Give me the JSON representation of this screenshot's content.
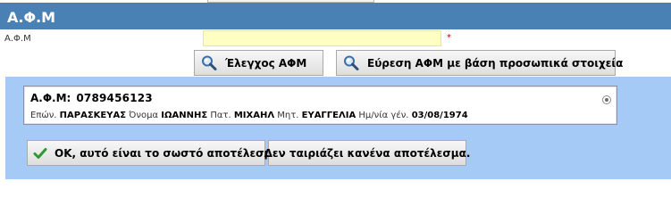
{
  "header": {
    "title": "Α.Φ.Μ"
  },
  "form": {
    "afm_label": "Α.Φ.Μ",
    "afm_value": "",
    "required_mark": "*"
  },
  "buttons": {
    "check_afm": "Έλεγχος ΑΦΜ",
    "find_afm": "Εύρεση ΑΦΜ με βάση προσωπικά στοιχεία",
    "confirm": "OK, αυτό είναι το σωστό αποτέλεσμα!",
    "no_match": "Δεν ταιριάζει κανένα αποτέλεσμα."
  },
  "result": {
    "afm_label": "Α.Φ.Μ:",
    "afm_value": "0789456123",
    "surname_label": "Επών.",
    "surname": "ΠΑΡΑΣΚΕΥΑΣ",
    "name_label": "Όνομα",
    "name": "ΙΩΑΝΝΗΣ",
    "father_label": "Πατ.",
    "father": "ΜΙΧΑΗΛ",
    "mother_label": "Μητ.",
    "mother": "ΕΥΑΓΓΕΛΙΑ",
    "dob_label": "Ημ/νία γέν.",
    "dob": "03/08/1974",
    "selected": true
  },
  "icons": {
    "search": "magnifier-icon",
    "check": "checkmark-icon",
    "radio": "radio-selected-icon"
  },
  "colors": {
    "header_bg": "#4a81b4",
    "panel_bg": "#a4caf5",
    "input_bg": "#ffffc4",
    "check_green": "#2e9a2e",
    "required_red": "#cc0000"
  }
}
